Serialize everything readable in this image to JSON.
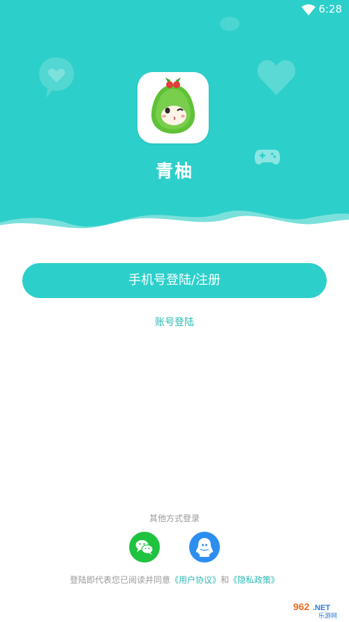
{
  "status_bar": {
    "time": "6:28"
  },
  "app": {
    "name": "青柚"
  },
  "actions": {
    "phone_login_label": "手机号登陆/注册",
    "account_login_label": "账号登陆"
  },
  "social": {
    "title": "其他方式登录",
    "buttons": [
      {
        "icon": "wechat-icon"
      },
      {
        "icon": "qq-icon"
      }
    ]
  },
  "agreement": {
    "prefix": "登陆即代表您已阅读并同意",
    "user_agreement": "《用户协议》",
    "conjunction": "和",
    "privacy_policy": "《隐私政策》"
  },
  "watermark": {
    "text_top": "962",
    "text_top_suffix": ".NET",
    "text_bottom": "乐游网"
  },
  "colors": {
    "primary": "#2dcfca",
    "link": "#2bb9b5",
    "wechat": "#1fc33f",
    "qq": "#2c8ff0"
  }
}
